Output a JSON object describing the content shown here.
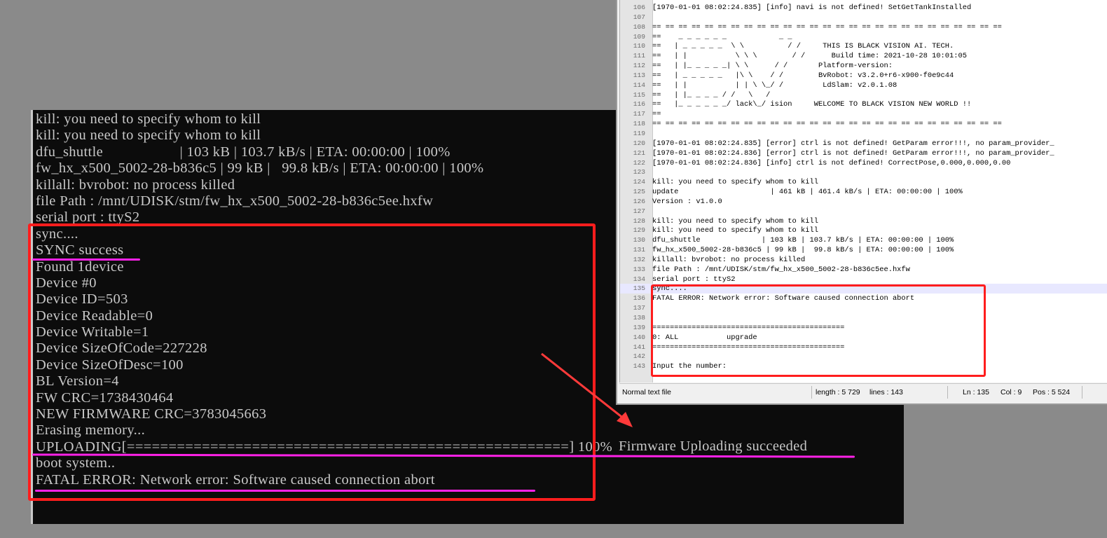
{
  "terminal": {
    "lines": [
      "kill: you need to specify whom to kill",
      "kill: you need to specify whom to kill",
      "dfu_shuttle                    | 103 kB | 103.7 kB/s | ETA: 00:00:00 | 100%",
      "fw_hx_x500_5002-28-b836c5 | 99 kB |   99.8 kB/s | ETA: 00:00:00 | 100%",
      "killall: bvrobot: no process killed",
      "file Path : /mnt/UDISK/stm/fw_hx_x500_5002-28-b836c5ee.hxfw",
      "serial port : ttyS2",
      "sync....",
      "SYNC success",
      "Found 1device",
      "Device #0",
      "Device ID=503",
      "Device Readable=0",
      "Device Writable=1",
      "Device SizeOfCode=227228",
      "Device SizeOfDesc=100",
      "BL Version=4",
      "FW CRC=1738430464",
      "NEW FIRMWARE CRC=3783045663",
      "Erasing memory...",
      "UPLOADING[=====================================================] 100%",
      "boot system..",
      "FATAL ERROR: Network error: Software caused connection abort"
    ]
  },
  "annotation": {
    "text": "Firmware Uploading succeeded",
    "box_color": "#ff1d1d",
    "underline_color": "#ff22e8"
  },
  "notepad": {
    "lines": [
      {
        "n": "106",
        "t": "[1970-01-01 08:02:24.835] [info] navi is not defined! SetGetTankInstalled"
      },
      {
        "n": "107",
        "t": ""
      },
      {
        "n": "108",
        "t": "== == == == == == == == == == == == == == == == == == == == == == == == == == =="
      },
      {
        "n": "109",
        "t": "==    _ _ _ _ _ _            _ _"
      },
      {
        "n": "110",
        "t": "==   | _ _ _ _ _  \\ \\          / /     THIS IS BLACK VISION AI. TECH."
      },
      {
        "n": "111",
        "t": "==   | |           \\ \\ \\        / /      Build time: 2021-10-28 10:01:05"
      },
      {
        "n": "112",
        "t": "==   | |_ _ _ _ _| \\ \\      / /       Platform-version:"
      },
      {
        "n": "113",
        "t": "==   | _ _ _ _ _   |\\ \\    / /        BvRobot: v3.2.0+r6-x900-f0e9c44"
      },
      {
        "n": "114",
        "t": "==   | |           | | \\ \\_/ /         LdSlam: v2.0.1.08"
      },
      {
        "n": "115",
        "t": "==   | |_ _ _ _ / /   \\   /"
      },
      {
        "n": "116",
        "t": "==   |_ _ _ _ _ _/ lack\\_/ ision     WELCOME TO BLACK VISION NEW WORLD !!"
      },
      {
        "n": "117",
        "t": "=="
      },
      {
        "n": "118",
        "t": "== == == == == == == == == == == == == == == == == == == == == == == == == == =="
      },
      {
        "n": "119",
        "t": ""
      },
      {
        "n": "120",
        "t": "[1970-01-01 08:02:24.835] [error] ctrl is not defined! GetParam error!!!, no param_provider_"
      },
      {
        "n": "121",
        "t": "[1970-01-01 08:02:24.836] [error] ctrl is not defined! GetParam error!!!, no param_provider_"
      },
      {
        "n": "122",
        "t": "[1970-01-01 08:02:24.836] [info] ctrl is not defined! CorrectPose,0.000,0.000,0.00"
      },
      {
        "n": "123",
        "t": ""
      },
      {
        "n": "124",
        "t": "kill: you need to specify whom to kill"
      },
      {
        "n": "125",
        "t": "update                     | 461 kB | 461.4 kB/s | ETA: 00:00:00 | 100%"
      },
      {
        "n": "126",
        "t": "Version : v1.0.0"
      },
      {
        "n": "127",
        "t": ""
      },
      {
        "n": "128",
        "t": "kill: you need to specify whom to kill"
      },
      {
        "n": "129",
        "t": "kill: you need to specify whom to kill"
      },
      {
        "n": "130",
        "t": "dfu_shuttle              | 103 kB | 103.7 kB/s | ETA: 00:00:00 | 100%"
      },
      {
        "n": "131",
        "t": "fw_hx_x500_5002-28-b836c5 | 99 kB |  99.8 kB/s | ETA: 00:00:00 | 100%"
      },
      {
        "n": "132",
        "t": "killall: bvrobot: no process killed"
      },
      {
        "n": "133",
        "t": "file Path : /mnt/UDISK/stm/fw_hx_x500_5002-28-b836c5ee.hxfw"
      },
      {
        "n": "134",
        "t": "serial port : ttyS2"
      },
      {
        "n": "135",
        "t": "sync...."
      },
      {
        "n": "136",
        "t": "FATAL ERROR: Network error: Software caused connection abort"
      },
      {
        "n": "137",
        "t": ""
      },
      {
        "n": "138",
        "t": ""
      },
      {
        "n": "139",
        "t": "============================================"
      },
      {
        "n": "140",
        "t": "0: ALL           upgrade"
      },
      {
        "n": "141",
        "t": "============================================"
      },
      {
        "n": "142",
        "t": ""
      },
      {
        "n": "143",
        "t": "Input the number:"
      }
    ],
    "current_line": "135",
    "status": {
      "file_type": "Normal text file",
      "length": "length : 5 729",
      "lines": "lines : 143",
      "ln": "Ln : 135",
      "col": "Col : 9",
      "pos": "Pos : 5 524"
    }
  }
}
